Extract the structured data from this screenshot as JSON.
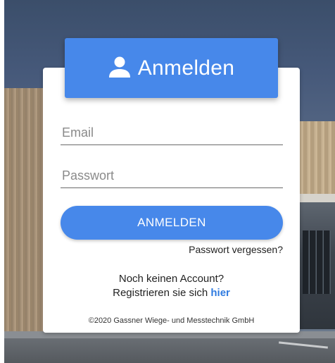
{
  "header": {
    "icon": "user-icon",
    "title": "Anmelden"
  },
  "form": {
    "email_placeholder": "Email",
    "password_placeholder": "Passwort",
    "submit_label": "ANMELDEN",
    "forgot_label": "Passwort vergessen?"
  },
  "register": {
    "question": "Noch keinen Account?",
    "prompt": "Registrieren sie sich",
    "link_label": "hier"
  },
  "footer": {
    "copyright": "©2020 Gassner Wiege- und Messtechnik GmbH"
  },
  "colors": {
    "accent": "#4788ea",
    "link": "#2f7be0"
  }
}
